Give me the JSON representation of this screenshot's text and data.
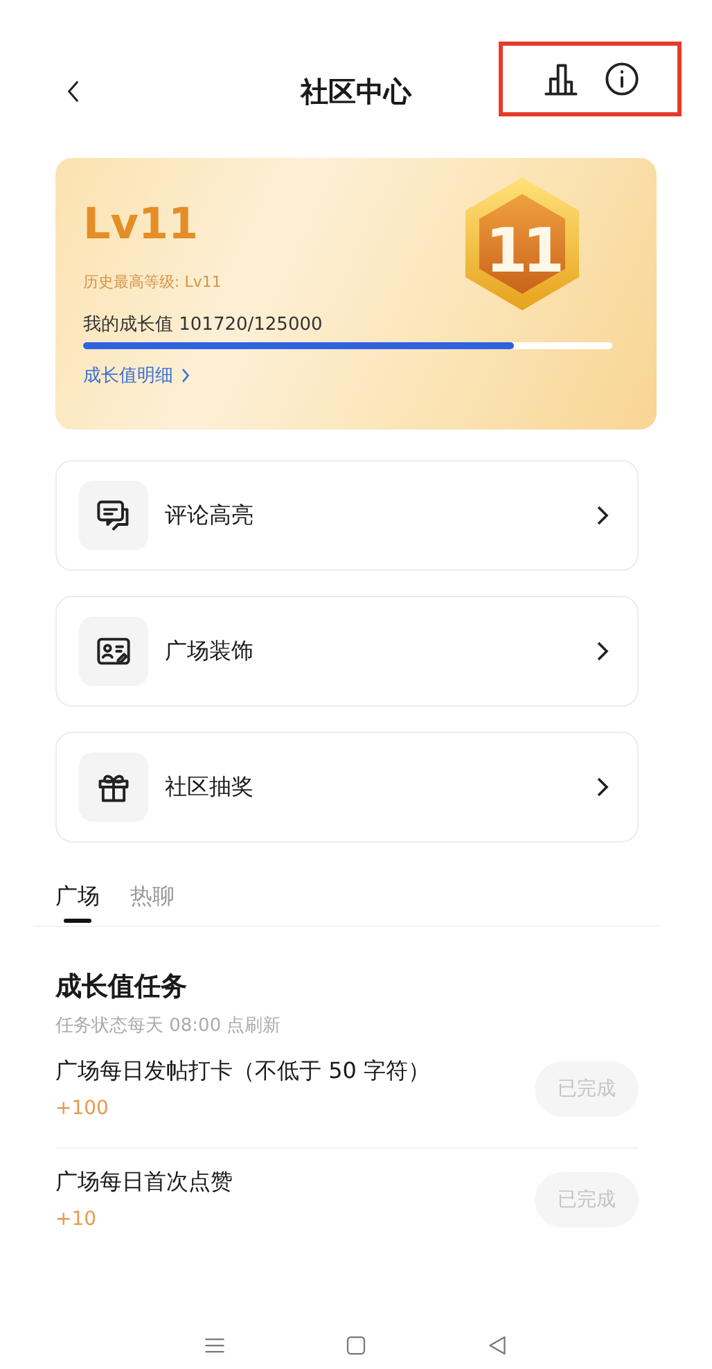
{
  "header": {
    "title": "社区中心",
    "highlighted_actions": true
  },
  "level_card": {
    "level": "Lv11",
    "badge": "11",
    "history": "历史最高等级: Lv11",
    "progress_label": "我的成长值 101720/125000",
    "progress": {
      "level": 0.814
    },
    "detail_link": "成长值明细"
  },
  "menu": [
    {
      "kind": "comment",
      "label": "评论高亮"
    },
    {
      "kind": "decoration",
      "label": "广场装饰"
    },
    {
      "kind": "gift",
      "label": "社区抽奖"
    }
  ],
  "tabs": [
    {
      "label": "广场",
      "selected": true
    },
    {
      "label": "热聊",
      "selected": false
    }
  ],
  "tasks_section": {
    "title": "成长值任务",
    "subtitle": "任务状态每天 08:00 点刷新"
  },
  "tasks": [
    {
      "title": "广场每日发帖打卡（不低于 50 字符）",
      "reward": "+100",
      "button": "已完成",
      "done": true
    },
    {
      "title": "广场每日首次点赞",
      "reward": "+10",
      "button": "已完成",
      "done": true
    }
  ]
}
